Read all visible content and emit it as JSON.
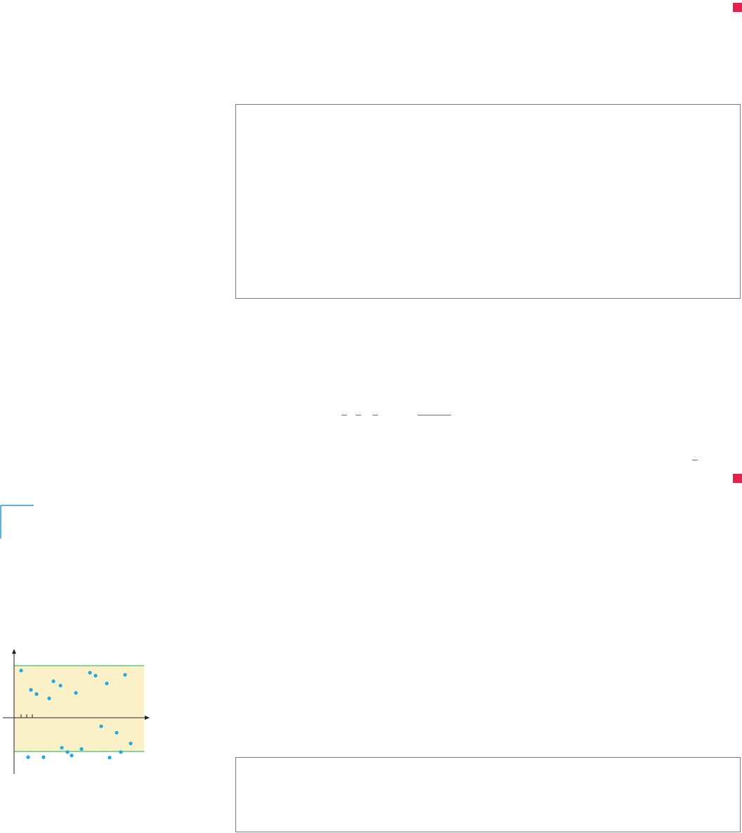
{
  "colors": {
    "end_mark": "#e0224c",
    "figure_band": "#fbf1c8",
    "band_edges": "#3fbf6a",
    "points": "#1eaae6",
    "margin_rule": "#1e9fd6",
    "frame_border": "#7a7a7a"
  },
  "figure": {
    "type": "scatter",
    "description_visible_text": "",
    "band": {
      "ylim": [
        -1.2,
        1.3
      ],
      "lower": -1,
      "upper": 1
    },
    "points": [
      [
        0.5,
        1.1
      ],
      [
        1.2,
        0.65
      ],
      [
        1.6,
        0.55
      ],
      [
        2.5,
        0.45
      ],
      [
        2.8,
        0.85
      ],
      [
        3.3,
        0.75
      ],
      [
        4.4,
        0.58
      ],
      [
        5.4,
        1.05
      ],
      [
        5.8,
        0.98
      ],
      [
        6.6,
        0.8
      ],
      [
        7.9,
        1.0
      ],
      [
        1.0,
        -0.92
      ],
      [
        2.1,
        -0.92
      ],
      [
        3.4,
        -0.7
      ],
      [
        3.8,
        -0.8
      ],
      [
        4.1,
        -0.88
      ],
      [
        4.8,
        -0.73
      ],
      [
        6.2,
        -0.2
      ],
      [
        6.8,
        -0.93
      ],
      [
        7.3,
        -0.35
      ],
      [
        7.6,
        -0.8
      ],
      [
        8.3,
        -0.6
      ]
    ]
  }
}
